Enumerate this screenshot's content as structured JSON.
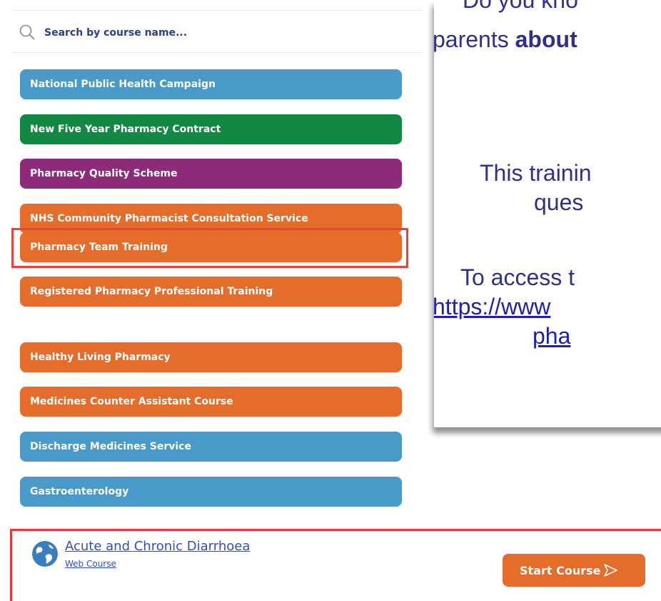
{
  "search": {
    "placeholder": "Search by course name..."
  },
  "categories": [
    {
      "label": "National Public Health Campaign",
      "color": "#4a9ac9"
    },
    {
      "label": "New Five Year Pharmacy Contract",
      "color": "#138845"
    },
    {
      "label": "Pharmacy Quality Scheme",
      "color": "#8d2a7a"
    },
    {
      "label": "NHS Community Pharmacist Consultation Service",
      "color": "#e56d2c"
    },
    {
      "label": "Pharmacy Team Training",
      "color": "#e56d2c",
      "highlighted": true
    },
    {
      "label": "Registered Pharmacy Professional Training",
      "color": "#e56d2c"
    },
    {
      "label": "Healthy Living Pharmacy",
      "color": "#e56d2c"
    },
    {
      "label": "Medicines Counter Assistant Course",
      "color": "#e56d2c"
    },
    {
      "label": "Discharge Medicines Service",
      "color": "#4a9ac9"
    },
    {
      "label": "Gastroenterology",
      "color": "#4a9ac9"
    }
  ],
  "card": {
    "line1": "Do you kno",
    "line2_a": "parents ",
    "line2_b": "about",
    "line3": "This trainin",
    "line4": "ques",
    "line5": "To access t",
    "link1": "https://www",
    "link2": "pha"
  },
  "course": {
    "title": "Acute and Chronic Diarrhoea",
    "type": "Web Course",
    "start_label": "Start Course",
    "icon": "globe-icon"
  },
  "colors": {
    "highlight": "#e83a36",
    "accent_orange": "#e56d2c",
    "link_blue": "#2f4fbf"
  }
}
